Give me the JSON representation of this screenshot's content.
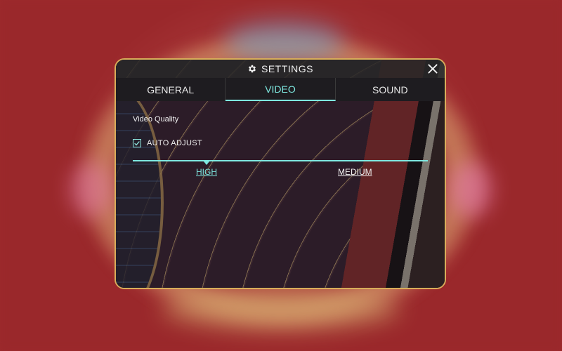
{
  "dialog": {
    "title": "SETTINGS",
    "tabs": [
      {
        "label": "GENERAL",
        "active": false
      },
      {
        "label": "VIDEO",
        "active": true
      },
      {
        "label": "SOUND",
        "active": false
      }
    ],
    "video": {
      "section_label": "Video Quality",
      "auto_adjust_label": "AUTO ADJUST",
      "auto_adjust_checked": true,
      "quality_options": [
        "HIGH",
        "MEDIUM"
      ],
      "selected_quality": "HIGH"
    }
  },
  "icons": {
    "settings": "gear-icon",
    "close": "close-icon",
    "checkbox": "checkmark-icon"
  },
  "colors": {
    "accent": "#7ee8e0",
    "border": "#d8ad5a",
    "background": "#9c2a2c"
  }
}
